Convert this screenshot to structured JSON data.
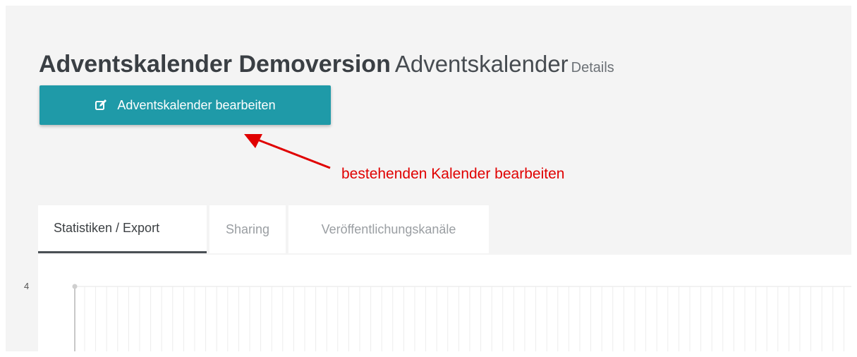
{
  "header": {
    "title_main": "Adventskalender Demoversion",
    "title_sub": "Adventskalender",
    "title_small": "Details"
  },
  "edit_button": {
    "label": "Adventskalender bearbeiten",
    "icon": "edit-icon",
    "color": "#1f9aa8"
  },
  "annotation": {
    "text": "bestehenden Kalender bearbeiten",
    "color": "#e00000"
  },
  "tabs": [
    {
      "label": "Statistiken / Export",
      "active": true
    },
    {
      "label": "Sharing",
      "active": false
    },
    {
      "label": "Veröffentlichungskanäle",
      "active": false
    }
  ],
  "chart": {
    "y_tick_label": "4"
  }
}
